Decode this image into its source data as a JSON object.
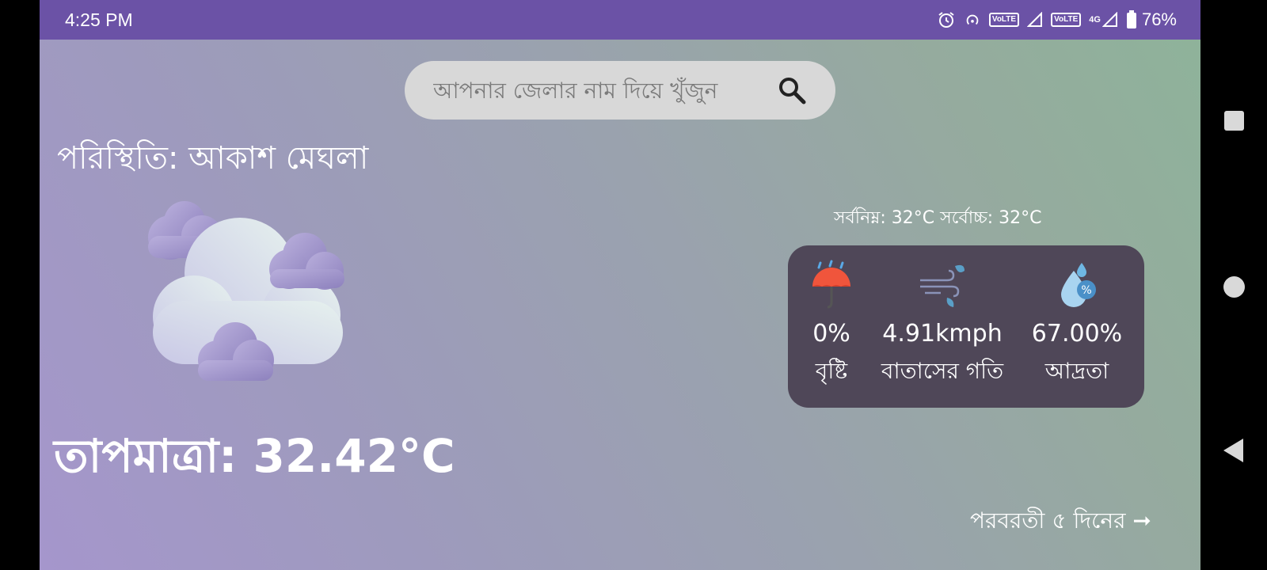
{
  "status_bar": {
    "time": "4:25 PM",
    "battery": "76%",
    "volte1": "VoLTE",
    "volte2": "VoLTE",
    "network": "4G"
  },
  "search": {
    "placeholder": "আপনার জেলার নাম দিয়ে খুঁজুন",
    "icon": "search-icon"
  },
  "weather": {
    "condition_text": "পরিস্থিতি: আকাশ মেঘলা",
    "icon": "cloudy-icon",
    "temperature_text": "তাপমাত্রা: 32.42°C",
    "minmax_text": "সর্বনিম্ন: 32°C সর্বোচ্চ: 32°C"
  },
  "stats": [
    {
      "icon": "umbrella-rain-icon",
      "value": "0%",
      "label": "বৃষ্টি"
    },
    {
      "icon": "wind-icon",
      "value": "4.91kmph",
      "label": "বাতাসের গতি"
    },
    {
      "icon": "humidity-icon",
      "value": "67.00%",
      "label": "আদ্রতা"
    }
  ],
  "forecast": {
    "label": "পরবরতী ৫ দিনের ➞"
  },
  "colors": {
    "status_bar": "#6b52a6",
    "card": "#4f4758",
    "search_bg": "#d8d8d8"
  }
}
